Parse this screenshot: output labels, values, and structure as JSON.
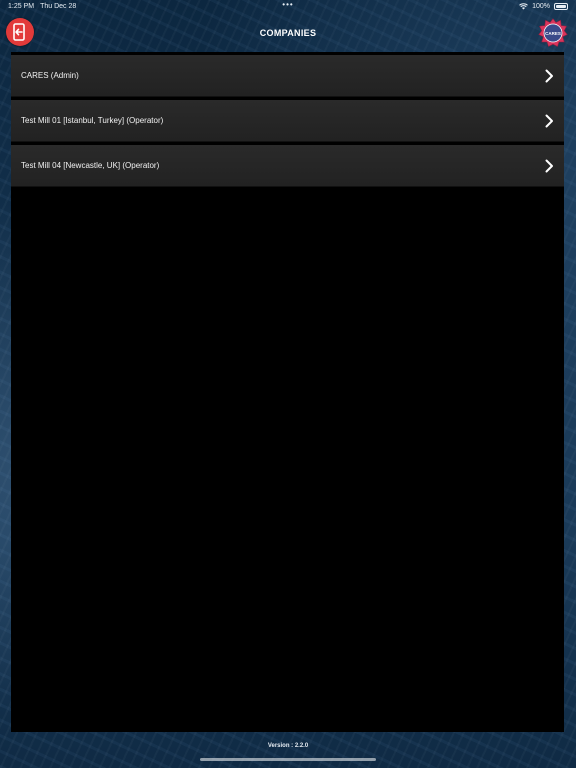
{
  "status_bar": {
    "time": "1:25 PM",
    "date": "Thu Dec 28",
    "center_dots": "•••",
    "battery": "100%"
  },
  "header": {
    "title": "COMPANIES",
    "logo_text": "CARES",
    "logout_icon": "logout-icon",
    "accent_red": "#e23a3a"
  },
  "companies": [
    {
      "label": "CARES (Admin)"
    },
    {
      "label": "Test Mill 01 [Istanbul, Turkey] (Operator)"
    },
    {
      "label": "Test Mill 04 [Newcastle, UK] (Operator)"
    }
  ],
  "footer": {
    "version": "Version : 2.2.0"
  }
}
